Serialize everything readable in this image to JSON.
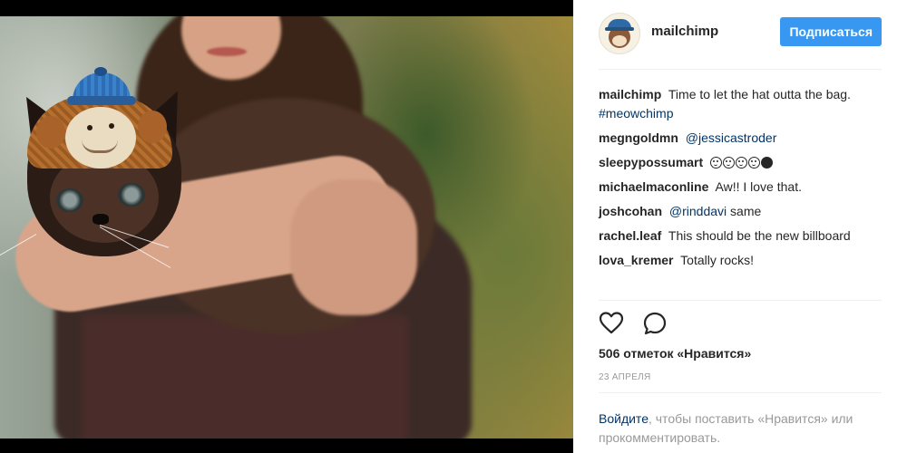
{
  "post": {
    "username": "mailchimp",
    "follow_label": "Подписаться",
    "caption": {
      "user": "mailchimp",
      "text": "Time to let the hat outta the bag.",
      "hashtag": "#meowchimp"
    },
    "comments": [
      {
        "user": "megngoldmn",
        "mention": "@jessicastroder"
      },
      {
        "user": "sleepypossumart",
        "emoji_count": 5
      },
      {
        "user": "michaelmaconline",
        "text": "Aw!! I love that."
      },
      {
        "user": "joshcohan",
        "mention": "@rinddavi",
        "text": "same"
      },
      {
        "user": "rachel.leaf",
        "text": "This should be the new billboard"
      },
      {
        "user": "lova_kremer",
        "text": "Totally rocks!"
      }
    ],
    "likes_text": "506 отметок «Нравится»",
    "date": "23 апреля",
    "login_link": "Войдите",
    "login_text": ", чтобы поставить «Нравится» или прокомментировать."
  },
  "colors": {
    "follow_button": "#3897f0",
    "link": "#003569",
    "muted": "#999999"
  },
  "icons": [
    "heart-icon",
    "comment-icon"
  ]
}
